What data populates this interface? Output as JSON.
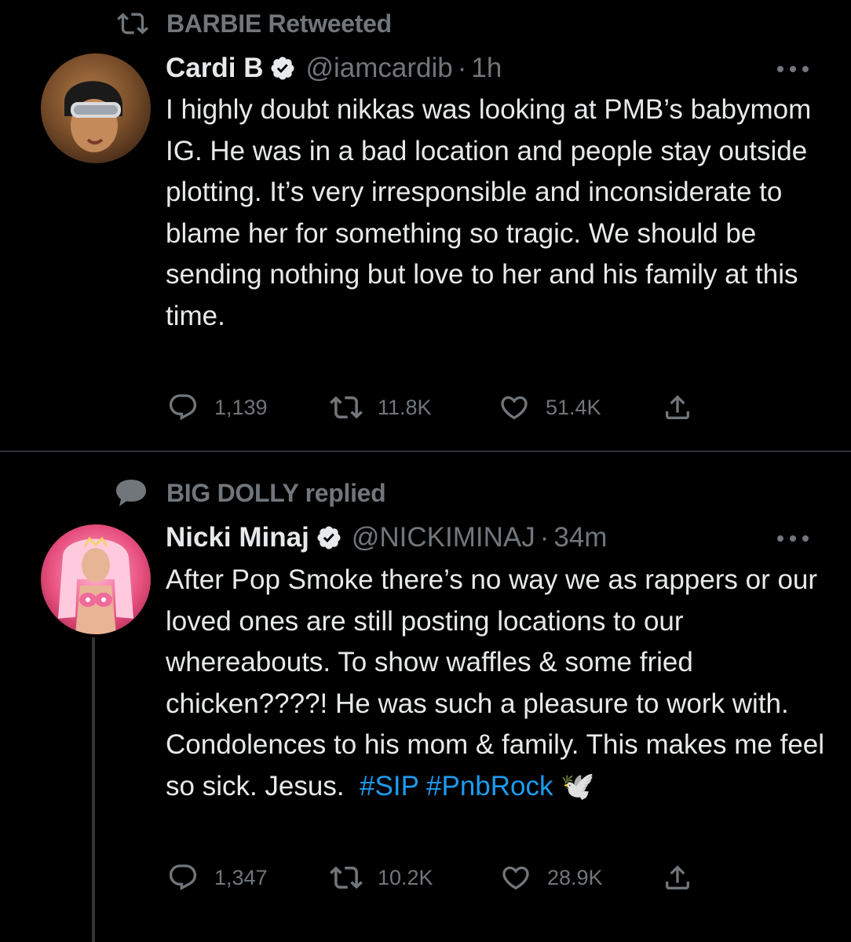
{
  "tweets": [
    {
      "context_icon": "retweet-icon",
      "context_text": "BARBIE Retweeted",
      "name": "Cardi B",
      "verified": true,
      "handle": "@iamcardib",
      "separator": "·",
      "time": "1h",
      "text": "I highly doubt nikkas was looking at PMB’s babymom IG. He was in a bad location and people stay outside plotting. It’s very irresponsible and inconsiderate to blame her for something so tragic. We should be sending nothing but love to her and his family at this time.",
      "replies": "1,139",
      "retweets": "11.8K",
      "likes": "51.4K"
    },
    {
      "context_icon": "reply-bubble-icon",
      "context_text": "BIG DOLLY replied",
      "name": "Nicki Minaj",
      "verified": true,
      "handle": "@NICKIMINAJ",
      "separator": "·",
      "time": "34m",
      "text": "After Pop Smoke there’s no way we as rappers or our loved ones are still posting locations to our whereabouts. To show waffles & some fried chicken????! He was such a pleasure to work with. Condolences to his mom & family. This makes me feel so sick. Jesus.",
      "hashtags": [
        "#SIP",
        "#PnbRock"
      ],
      "emoji": "🕊️",
      "replies": "1,347",
      "retweets": "10.2K",
      "likes": "28.9K"
    }
  ],
  "colors": {
    "background": "#000000",
    "text": "#e7e9ea",
    "secondary": "#71767b",
    "link": "#1d9bf0",
    "divider": "#2f3336"
  }
}
